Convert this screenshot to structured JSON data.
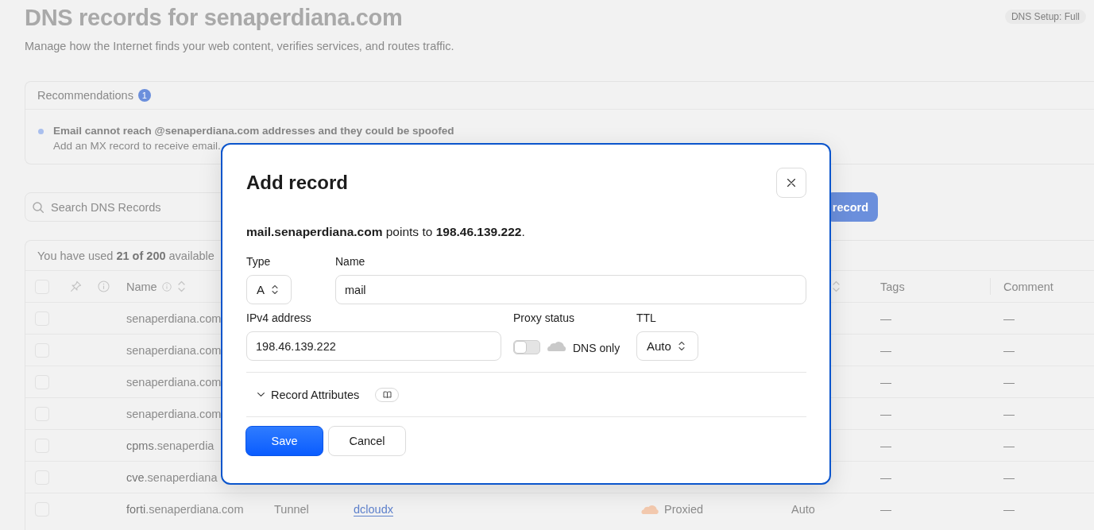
{
  "page_header": {
    "title": "DNS records for senaperdiana.com",
    "subtitle": "Manage how the Internet finds your web content, verifies services, and routes traffic.",
    "setup_badge": "DNS Setup: Full"
  },
  "recommendations": {
    "title": "Recommendations",
    "count": "1",
    "items": [
      {
        "title": "Email cannot reach @senaperdiana.com addresses and they could be spoofed",
        "text": "Add an MX record to receive email."
      }
    ]
  },
  "toolbar": {
    "search": {
      "placeholder": "Search DNS Records"
    },
    "add_button": {
      "label": "record"
    }
  },
  "records_table": {
    "usage": "You have used **21 of 200** available",
    "select_all_checked": false,
    "columns": {
      "name": "Name",
      "tags": "Tags",
      "comment": "Comment"
    },
    "rows": [
      {
        "checked": false,
        "name": "senaperdiana.com",
        "tags": "—",
        "comment": "—"
      },
      {
        "checked": false,
        "name": "senaperdiana.com",
        "tags": "—",
        "comment": "—"
      },
      {
        "checked": false,
        "name": "senaperdiana.com",
        "tags": "—",
        "comment": "—"
      },
      {
        "checked": false,
        "name": "senaperdiana.com",
        "tags": "—",
        "comment": "—"
      },
      {
        "checked": false,
        "name_prefix": "cpms",
        "name": ".senaperdia",
        "tags": "—",
        "comment": "—"
      },
      {
        "checked": false,
        "name_prefix": "cve",
        "name": ".senaperdiana",
        "tags": "—",
        "comment": "—"
      },
      {
        "checked": false,
        "name_prefix": "forti",
        "name": ".senaperdiana.com",
        "type": "Tunnel",
        "content": "dcloudx",
        "proxy": {
          "proxied": true,
          "label": "Proxied"
        },
        "ttl": "Auto",
        "tags": "—",
        "comment": "—"
      }
    ]
  },
  "dialog": {
    "title": "Add record",
    "summary": "**mail.senaperdiana.com** points to **198.46.139.222**.",
    "type_field": {
      "label": "Type",
      "value": "A"
    },
    "name_field": {
      "label": "Name",
      "value": "mail"
    },
    "ipv4_field": {
      "label": "IPv4 address",
      "value": "198.46.139.222"
    },
    "proxy_status": {
      "label": "Proxy status",
      "on": false,
      "text": "DNS only"
    },
    "ttl_field": {
      "label": "TTL",
      "value": "Auto"
    },
    "record_attributes": {
      "label": "Record Attributes",
      "expanded": false
    },
    "buttons": [
      {
        "label": "Save",
        "kind": "primary"
      },
      {
        "label": "Cancel",
        "kind": "secondary"
      }
    ]
  }
}
